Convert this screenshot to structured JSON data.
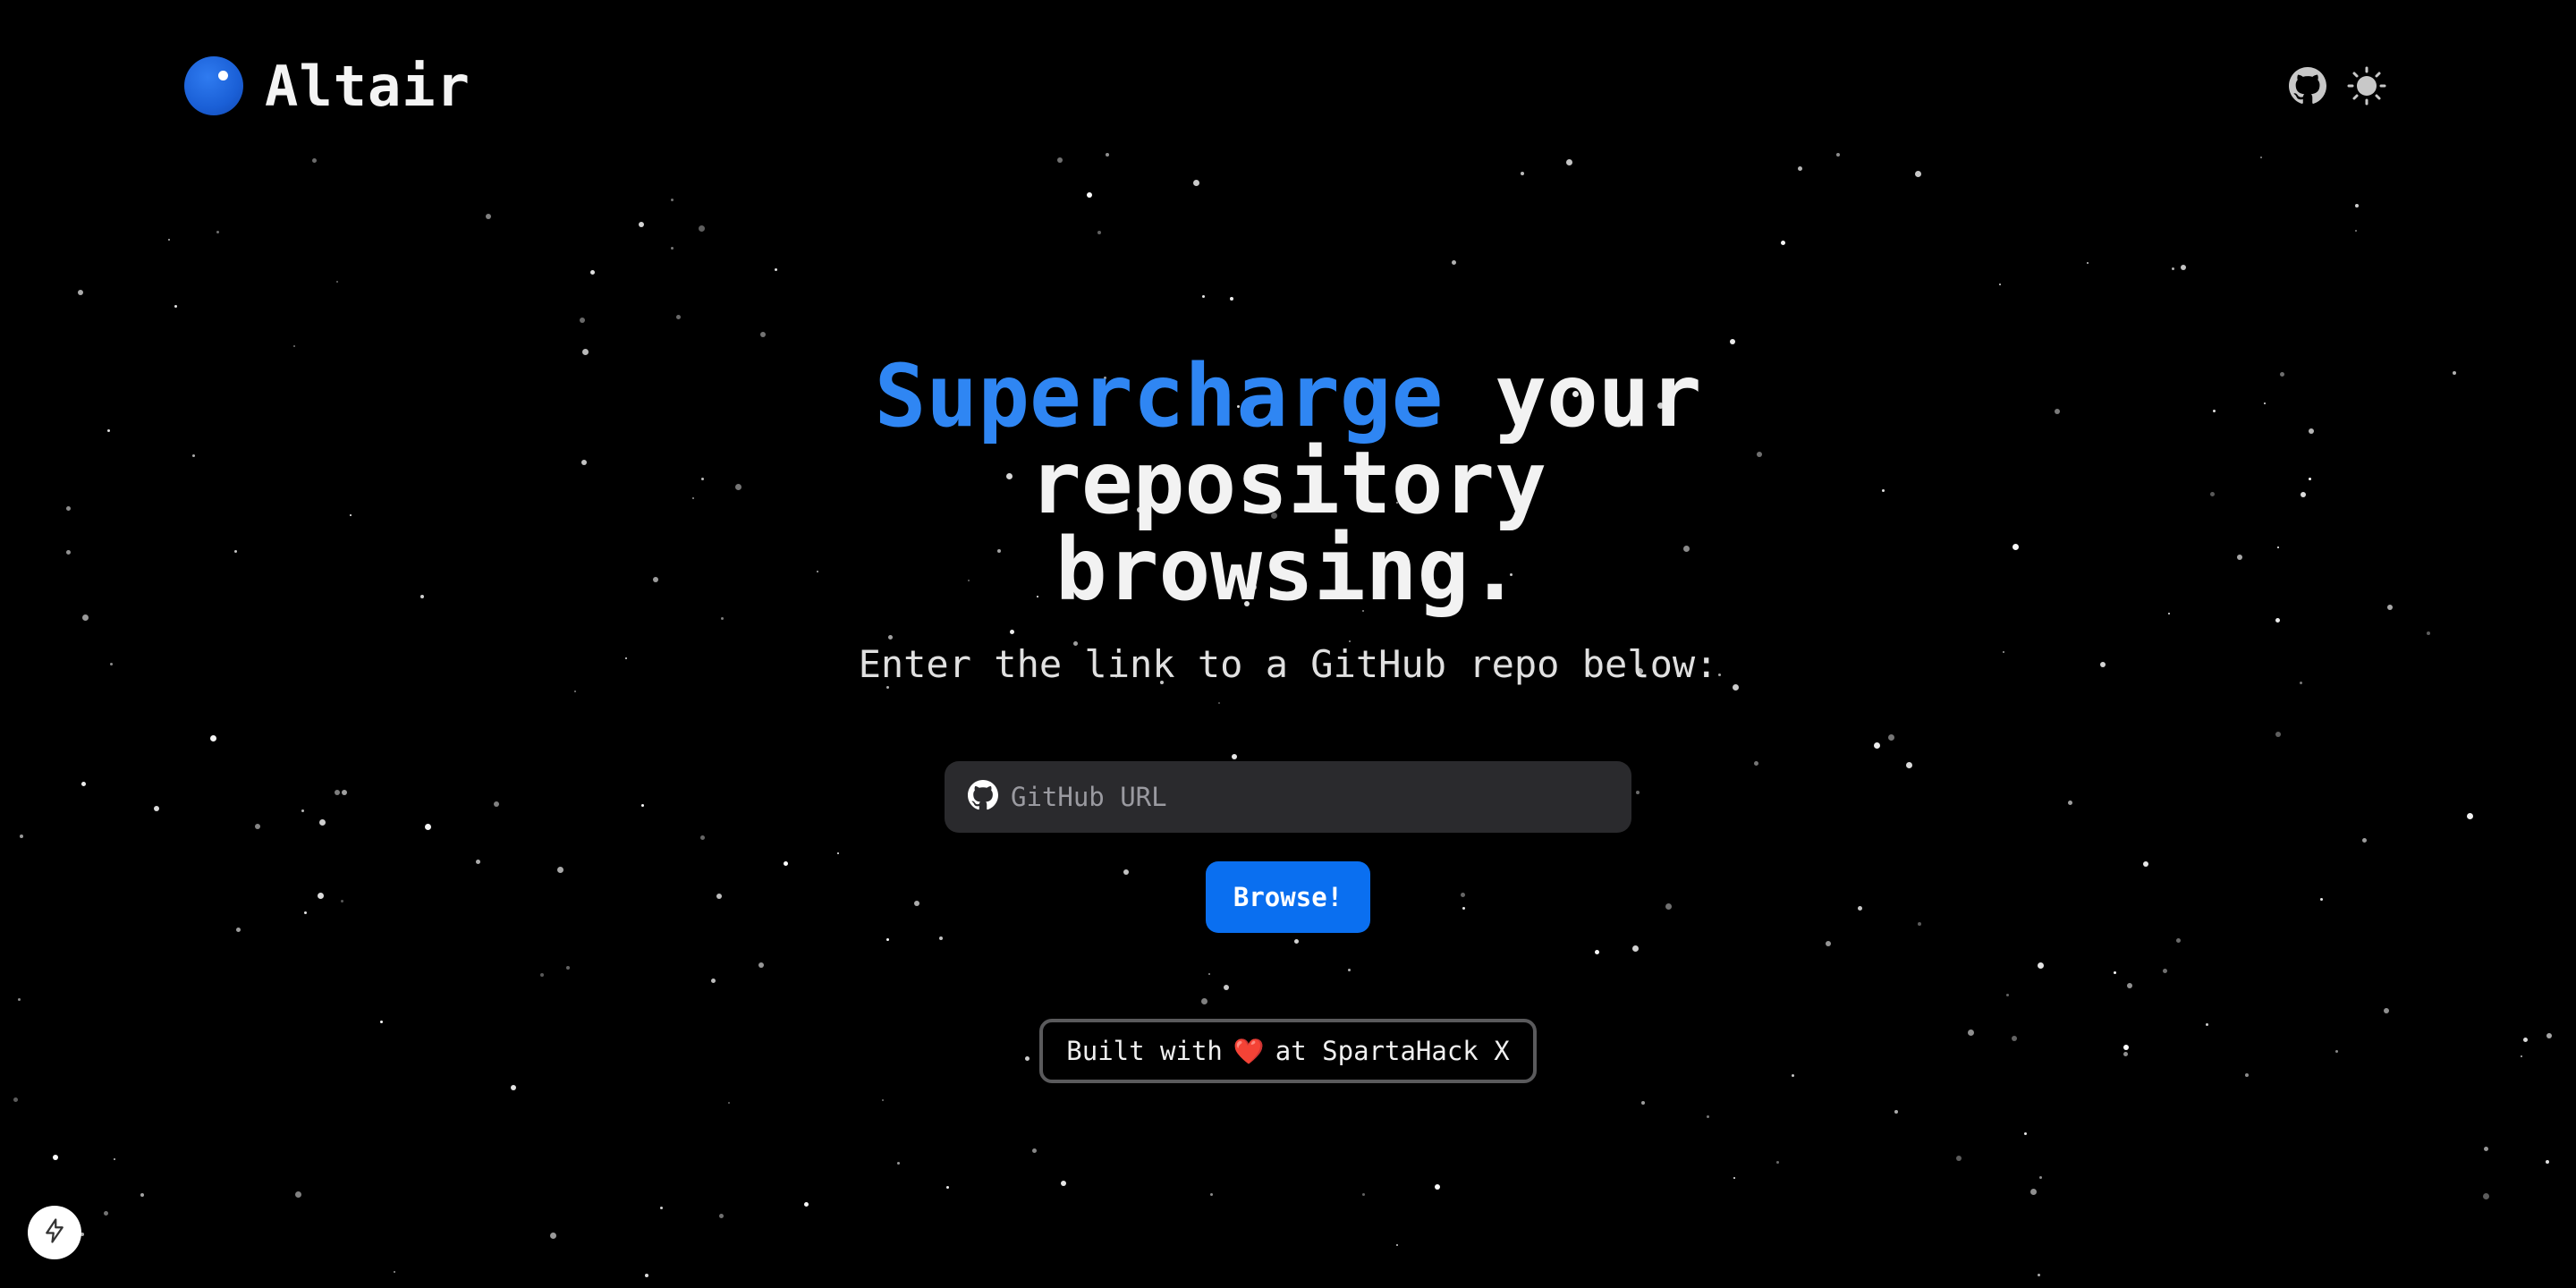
{
  "app": {
    "name": "Altair",
    "logo_icon": "altair-planet-logo",
    "accent_color": "#2f86f3"
  },
  "header": {
    "actions": [
      {
        "icon": "github-icon",
        "label": ""
      },
      {
        "icon": "sun-icon",
        "label": ""
      }
    ]
  },
  "hero": {
    "headline_accent": "Supercharge",
    "headline_rest": "your repository browsing.",
    "subtitle": "Enter the link to a GitHub repo below:",
    "url_input": {
      "icon": "github-icon",
      "value": "",
      "placeholder": "GitHub URL"
    },
    "browse_label": "Browse!",
    "button_color": "#0a6ff0"
  },
  "footer": {
    "credit_before": "Built with",
    "heart": "❤️",
    "credit_after": "at SpartaHack X"
  },
  "corner_badge": {
    "icon": "lightning-bolt-icon"
  }
}
